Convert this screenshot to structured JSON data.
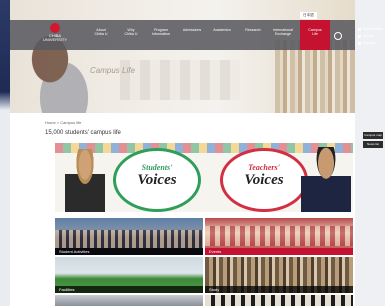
{
  "header": {
    "logo_text": "CHIBA\nUNIVERSITY",
    "lang_label": "日本語",
    "nav": [
      {
        "label": "About\nChiba U"
      },
      {
        "label": "Why\nChiba U"
      },
      {
        "label": "Program\nInformation"
      },
      {
        "label": "Admissions"
      },
      {
        "label": "Academics"
      },
      {
        "label": "Research"
      },
      {
        "label": "International\nExchange"
      },
      {
        "label": "Campus\nLife"
      }
    ],
    "utility": [
      "Accessibility",
      "Access",
      "Contact"
    ]
  },
  "hero": {
    "caption": "Campus Life"
  },
  "breadcrumb": "Home > Campus life",
  "page_title": "15,000 students' campus life",
  "banner": {
    "students_small": "Students'",
    "students_big": "Voices",
    "teachers_small": "Teachers'",
    "teachers_big": "Voices"
  },
  "tiles": [
    {
      "label": "Student Activities"
    },
    {
      "label": "Events"
    },
    {
      "label": "Facilities"
    },
    {
      "label": "Study"
    }
  ],
  "side_buttons": [
    "Campus map",
    "News list"
  ],
  "colors": {
    "accent": "#c41230",
    "nav_bg": "#5a5a60"
  }
}
